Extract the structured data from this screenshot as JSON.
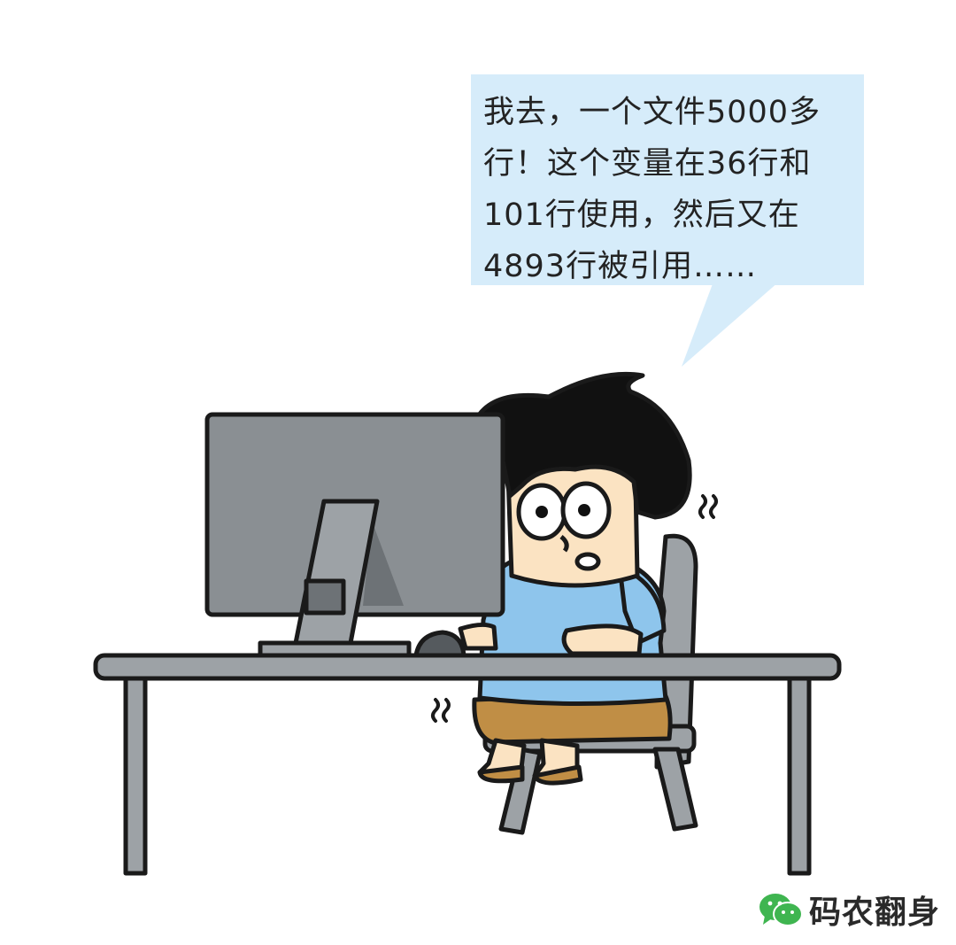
{
  "speech_bubble": {
    "lines": [
      "我去，一个文件5000多",
      "行！这个变量在36行和",
      "101行使用，然后又在",
      "4893行被引用……"
    ]
  },
  "watermark": {
    "icon": "wechat-icon",
    "text": "码农翻身"
  },
  "colors": {
    "bubble": "#d6ecfa",
    "monitor": "#8a8f93",
    "shirt": "#8ec5ec",
    "shorts": "#c08e45",
    "desk": "#9da2a6",
    "skin": "#fbe3c2",
    "wechat_green": "#3fb550"
  }
}
